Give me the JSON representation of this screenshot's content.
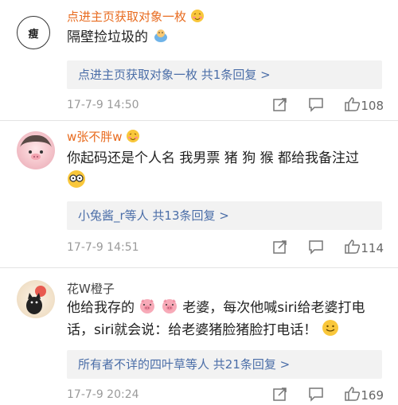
{
  "comments": [
    {
      "username": "点进主页获取对象一枚",
      "avatar_text": "瘦",
      "text": "隔壁捡垃圾的",
      "reply_summary": "点进主页获取对象一枚  共1条回复 >",
      "time": "17-7-9 14:50",
      "likes": "108"
    },
    {
      "username": "w张不胖w",
      "text": "你起码还是个人名 我男票 猪 狗 猴 都给我备注过",
      "reply_summary": "小兔酱_r等人  共13条回复 >",
      "time": "17-7-9 14:51",
      "likes": "114"
    },
    {
      "username": "花W橙子",
      "text_line1_a": "他给我存的",
      "text_line1_b": "老婆，每次他喊siri给老婆打电",
      "text_line2": "话，siri就会说：给老婆猪脸猪脸打电话！",
      "reply_summary": "所有者不详的四叶草等人  共21条回复 >",
      "time": "17-7-9 20:24",
      "likes": "169"
    }
  ],
  "icons": [
    "share-icon",
    "comment-icon",
    "like-icon",
    "blush-emoji",
    "pig-emoji",
    "smile-emoji",
    "glasses-emoji"
  ]
}
